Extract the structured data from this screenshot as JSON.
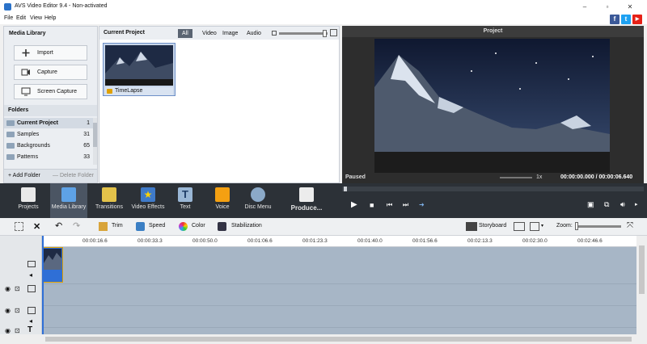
{
  "window": {
    "title": "AVS Video Editor 9.4 - Non-activated"
  },
  "menu": [
    "File",
    "Edit",
    "View",
    "Help"
  ],
  "social": {
    "facebook": "f",
    "twitter": "t",
    "youtube": "▶"
  },
  "media_library": {
    "title": "Media Library",
    "buttons": [
      "Import",
      "Capture",
      "Screen Capture"
    ],
    "folders_title": "Folders",
    "folders": [
      {
        "name": "Current Project",
        "count": "1"
      },
      {
        "name": "Samples",
        "count": "31"
      },
      {
        "name": "Backgrounds",
        "count": "65"
      },
      {
        "name": "Patterns",
        "count": "33"
      }
    ],
    "add_folder": "+ Add Folder",
    "delete_folder": "— Delete Folder"
  },
  "current_project": {
    "title": "Current Project",
    "filters": [
      "All",
      "Video",
      "Image",
      "Audio"
    ],
    "clip_name": "TimeLapse"
  },
  "preview": {
    "title": "Project",
    "status": "Paused",
    "speed": "1x",
    "time": "00:00:00.000 / 00:00:06.640"
  },
  "toolbar": [
    "Projects",
    "Media Library",
    "Transitions",
    "Video Effects",
    "Text",
    "Voice",
    "Disc Menu",
    "Produce..."
  ],
  "edit_toolbar": {
    "trim": "Trim",
    "speed": "Speed",
    "color": "Color",
    "stabilization": "Stabilization",
    "storyboard": "Storyboard",
    "zoom": "Zoom:"
  },
  "ruler": [
    "00:00:16.6",
    "00:00:33.3",
    "00:00:50.0",
    "00:01:06.6",
    "00:01:23.3",
    "00:01:40.0",
    "00:01:56.6",
    "00:02:13.3",
    "00:02:30.0",
    "00:02:46.6"
  ]
}
